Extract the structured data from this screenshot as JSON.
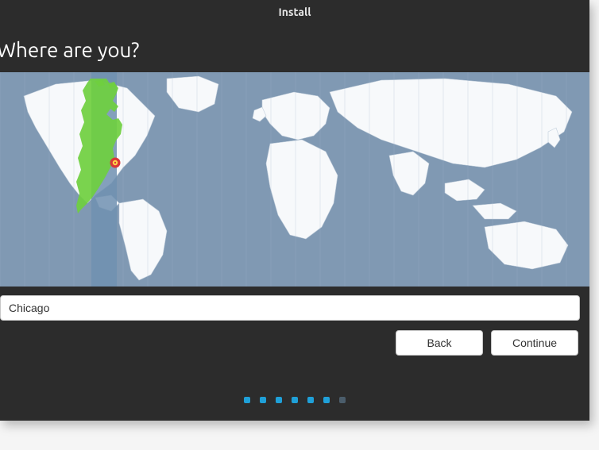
{
  "window": {
    "title": "Install"
  },
  "header": {
    "heading": "Where are you?"
  },
  "location": {
    "input_value": "Chicago",
    "input_placeholder": ""
  },
  "buttons": {
    "back_label": "Back",
    "continue_label": "Continue"
  },
  "progress": {
    "total_steps": 7,
    "current_step": 7
  },
  "colors": {
    "map_bg": "#8099b3",
    "land": "#f7f9fb",
    "highlight_band": "#7090b0",
    "highlight_region": "#6fcf3f",
    "pin_outer": "#d93838",
    "pin_inner": "#ffd84a",
    "dot_active": "#1fa0d8",
    "dot_inactive": "#4b5d6b"
  }
}
